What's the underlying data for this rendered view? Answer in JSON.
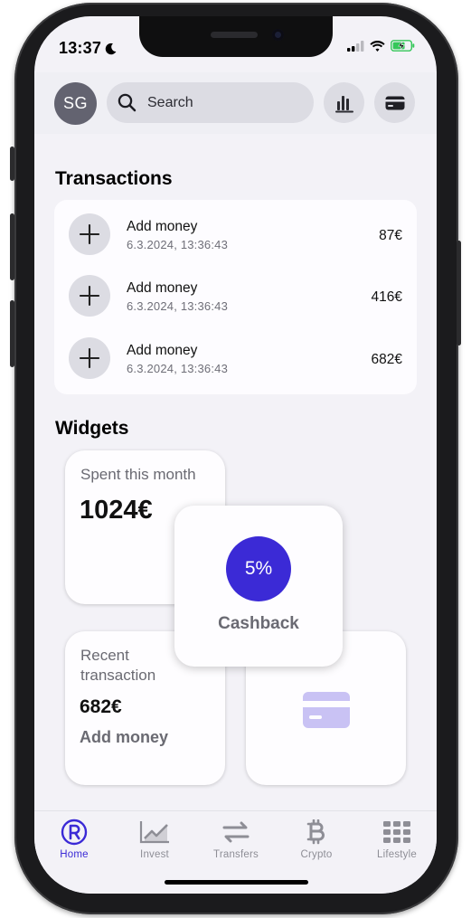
{
  "status": {
    "time": "13:37"
  },
  "header": {
    "avatar_initials": "SG",
    "search_placeholder": "Search"
  },
  "transactions": {
    "title": "Transactions",
    "items": [
      {
        "title": "Add money",
        "date": "6.3.2024, 13:36:43",
        "amount": "87€"
      },
      {
        "title": "Add money",
        "date": "6.3.2024, 13:36:43",
        "amount": "416€"
      },
      {
        "title": "Add money",
        "date": "6.3.2024, 13:36:43",
        "amount": "682€"
      }
    ]
  },
  "widgets": {
    "title": "Widgets",
    "spent": {
      "label": "Spent this month",
      "value": "1024€"
    },
    "cashback": {
      "percent": "5%",
      "label": "Cashback"
    },
    "recent": {
      "label": "Recent transaction",
      "value": "682€",
      "description": "Add money"
    }
  },
  "tabbar": {
    "items": [
      {
        "label": "Home",
        "icon": "revolut-r-icon",
        "active": true
      },
      {
        "label": "Invest",
        "icon": "chart-line-icon"
      },
      {
        "label": "Transfers",
        "icon": "transfer-arrows-icon"
      },
      {
        "label": "Crypto",
        "icon": "bitcoin-icon"
      },
      {
        "label": "Lifestyle",
        "icon": "grid-icon"
      }
    ]
  },
  "colors": {
    "accent": "#3b2ad6",
    "background": "#f3f2f7",
    "card": "#fdfcff",
    "muted_button": "#dcdce3",
    "card_icon_tint": "#c9c2f4"
  }
}
